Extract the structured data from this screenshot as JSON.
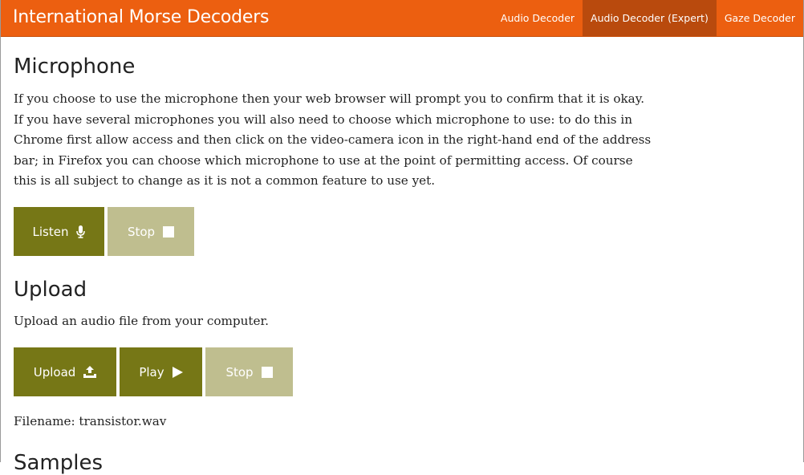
{
  "header": {
    "title": "International Morse Decoders",
    "nav": [
      {
        "label": "Audio Decoder",
        "active": false
      },
      {
        "label": "Audio Decoder (Expert)",
        "active": true
      },
      {
        "label": "Gaze Decoder",
        "active": false
      }
    ]
  },
  "microphone": {
    "heading": "Microphone",
    "description": "If you choose to use the microphone then your web browser will prompt you to confirm that it is okay. If you have several microphones you will also need to choose which microphone to use: to do this in Chrome first allow access and then click on the video-camera icon in the right-hand end of the address bar; in Firefox you can choose which microphone to use at the point of permitting access. Of course this is all subject to change as it is not a common feature to use yet.",
    "listen_label": "Listen",
    "listen_icon": "microphone-icon",
    "stop_label": "Stop",
    "stop_icon": "stop-icon"
  },
  "upload": {
    "heading": "Upload",
    "description": "Upload an audio file from your computer.",
    "upload_label": "Upload",
    "upload_icon": "upload-icon",
    "play_label": "Play",
    "play_icon": "play-icon",
    "stop_label": "Stop",
    "stop_icon": "stop-icon",
    "filename_label": "Filename:",
    "filename": "transistor.wav"
  },
  "samples": {
    "heading": "Samples"
  },
  "colors": {
    "header_bg": "#ec5f10",
    "nav_active_bg": "#b94a0d",
    "button_primary": "#767716",
    "button_disabled": "#bfbe8f"
  }
}
